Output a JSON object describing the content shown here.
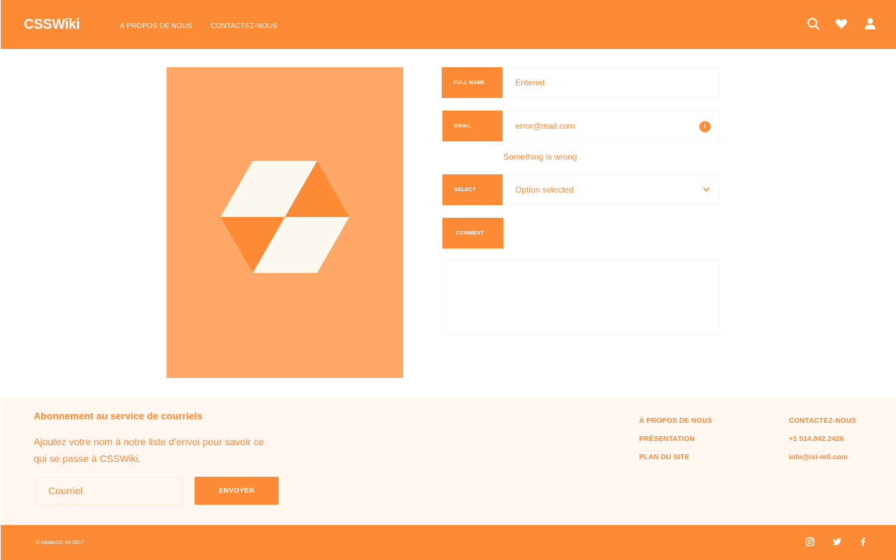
{
  "header": {
    "brand": "CSSWiki",
    "nav": [
      "À PROPOS DE NOUS",
      "CONTACTEZ-NOUS"
    ],
    "icons": [
      "search-icon",
      "heart-icon",
      "user-icon"
    ]
  },
  "form": {
    "full_name": {
      "label": "FULL NAME",
      "value": "Entered"
    },
    "email": {
      "label": "EMAIL",
      "value": "error@mail.com",
      "error": "Something is wrong"
    },
    "select": {
      "label": "SELECT",
      "value": "Option selected"
    },
    "comment": {
      "label": "COMMENT",
      "value": ""
    }
  },
  "newsletter": {
    "title": "Abonnement au service de courriels",
    "description": "Ajoutez votre nom à notre liste d’envoi pour savoir ce qui se passe à CSSWiki.",
    "input_placeholder": "Courriel",
    "button": "ENVOYER"
  },
  "footer_links": {
    "col1": [
      "À PROPOS DE NOUS",
      "PRÉSENTATION",
      "PLAN DU SITE"
    ],
    "col2": [
      "CONTACTEZ-NOUS",
      "+1 514.842.2426",
      "info@isi-mtl.com"
    ]
  },
  "footer": {
    "copyright": "© AdobeXD Kit 2017",
    "social": [
      "instagram-icon",
      "twitter-icon",
      "facebook-icon"
    ]
  },
  "colors": {
    "accent": "#fd8a35",
    "hero_bg": "#ffa766",
    "light_bg": "#fff7f0",
    "cream": "#fbf8ef"
  }
}
